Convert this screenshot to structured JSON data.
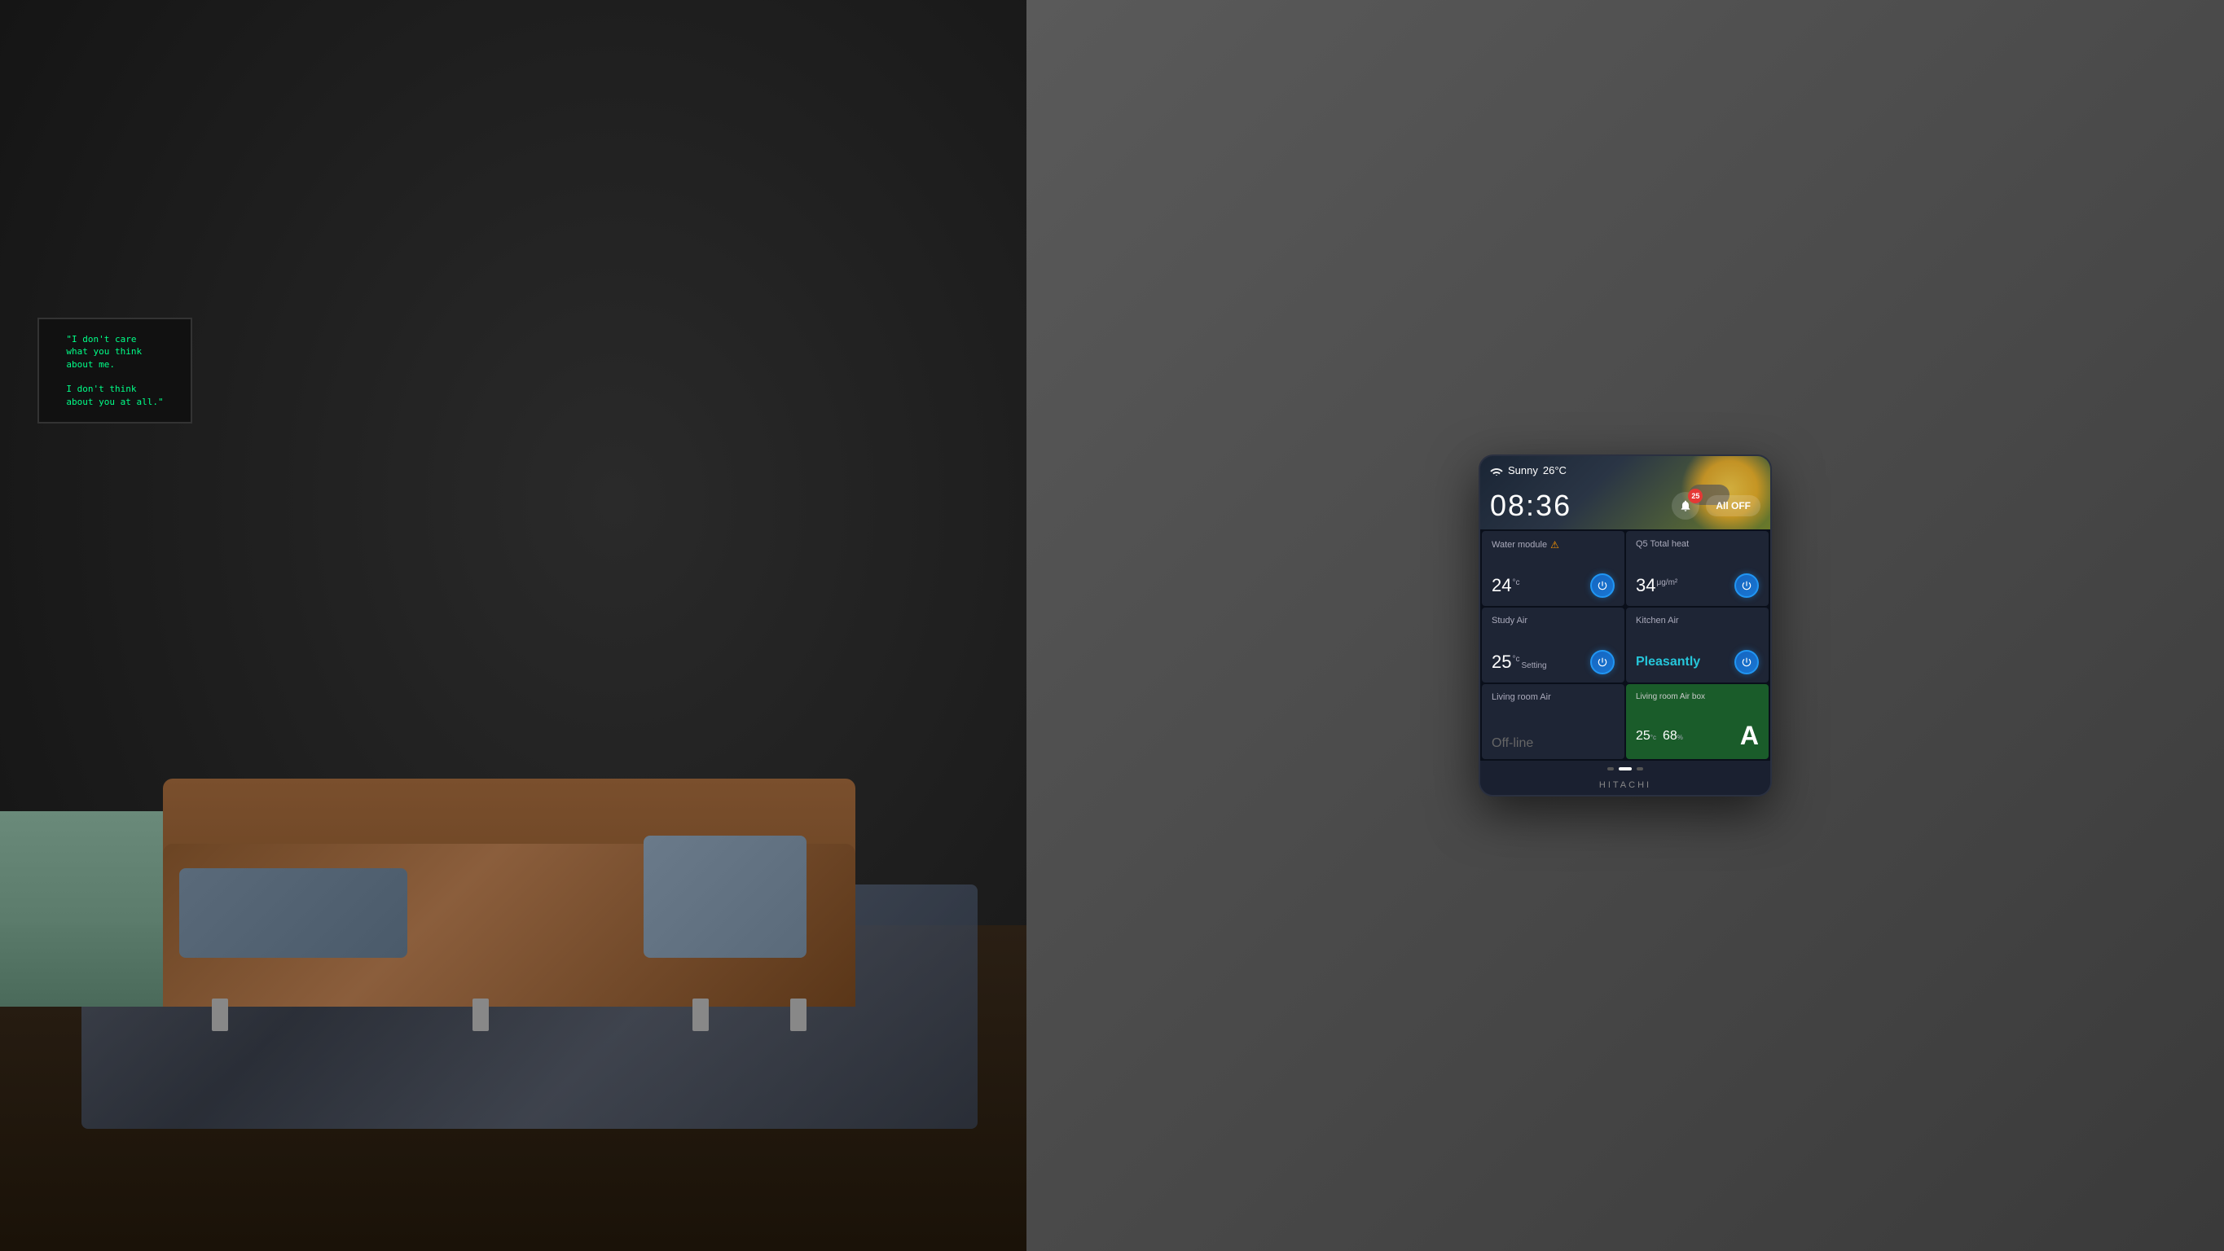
{
  "weather": {
    "condition": "Sunny",
    "temperature": "26°C",
    "time": "08:36"
  },
  "header": {
    "notification_count": "25",
    "all_off_label": "All OFF"
  },
  "cards": {
    "water_module": {
      "title": "Water module",
      "warning": "⚠",
      "temp": "24",
      "unit": "°c"
    },
    "q5_total_heat": {
      "title": "Q5 Total heat",
      "value": "34",
      "unit": "μg/m²"
    },
    "study_air": {
      "title": "Study Air",
      "temp": "25",
      "unit": "°c",
      "setting": "Setting"
    },
    "kitchen_air": {
      "title": "Kitchen Air",
      "status": "Pleasantly"
    },
    "living_room_air": {
      "title": "Living room Air",
      "status": "Off-line"
    },
    "living_room_air_box": {
      "title": "Living room Air box",
      "temp": "25",
      "temp_unit": "°c",
      "humidity": "68",
      "humidity_unit": "%",
      "grade": "A"
    }
  },
  "footer": {
    "brand": "HITACHI"
  },
  "wall_art": {
    "line1": "\"I don't care",
    "line2": "what you think",
    "line3": "about me.",
    "line4": "",
    "line5": "I don't think",
    "line6": "about you at all.\""
  }
}
